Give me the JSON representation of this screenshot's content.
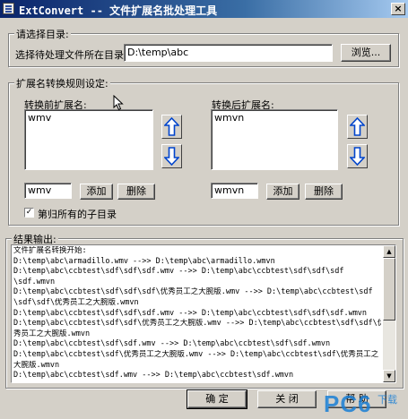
{
  "window": {
    "title": "ExtConvert -- 文件扩展名批处理工具",
    "close_glyph": "×"
  },
  "directory_group": {
    "legend": "请选择目录:",
    "label": "选择待处理文件所在目录：",
    "path_value": "D:\\temp\\abc",
    "browse_label": "浏览..."
  },
  "rules_group": {
    "legend": "扩展名转换规则设定:",
    "before": {
      "label": "转换前扩展名:",
      "items": [
        "wmv"
      ],
      "input_value": "wmv",
      "add_label": "添加",
      "delete_label": "删除"
    },
    "after": {
      "label": "转换后扩展名:",
      "items": [
        "wmvn"
      ],
      "input_value": "wmvn",
      "add_label": "添加",
      "delete_label": "删除"
    },
    "recursive_label": "第归所有的子目录",
    "recursive_checked": true,
    "check_glyph": "✓"
  },
  "output_group": {
    "legend": "结果输出:",
    "lines": [
      "文件扩展名转换开始:",
      "D:\\temp\\abc\\armadillo.wmv  -->>  D:\\temp\\abc\\armadillo.wmvn",
      "D:\\temp\\abc\\ccbtest\\sdf\\sdf\\sdf.wmv  -->>  D:\\temp\\abc\\ccbtest\\sdf\\sdf\\sdf",
      "\\sdf.wmvn",
      "D:\\temp\\abc\\ccbtest\\sdf\\sdf\\sdf\\优秀员工之大腕版.wmv  -->>  D:\\temp\\abc\\ccbtest\\sdf",
      "\\sdf\\sdf\\优秀员工之大腕版.wmvn",
      "D:\\temp\\abc\\ccbtest\\sdf\\sdf\\sdf.wmv  -->>  D:\\temp\\abc\\ccbtest\\sdf\\sdf\\sdf.wmvn",
      "D:\\temp\\abc\\ccbtest\\sdf\\sdf\\优秀员工之大腕版.wmv  -->>  D:\\temp\\abc\\ccbtest\\sdf\\sdf\\优",
      "秀员工之大腕版.wmvn",
      "D:\\temp\\abc\\ccbtest\\sdf\\sdf.wmv  -->>  D:\\temp\\abc\\ccbtest\\sdf\\sdf.wmvn",
      "D:\\temp\\abc\\ccbtest\\sdf\\优秀员工之大腕版.wmv  -->>  D:\\temp\\abc\\ccbtest\\sdf\\优秀员工之",
      "大腕版.wmvn",
      "D:\\temp\\abc\\ccbtest\\sdf.wmv  -->>  D:\\temp\\abc\\ccbtest\\sdf.wmvn"
    ]
  },
  "footer": {
    "ok_label": "确 定",
    "close_label": "关 闭",
    "help_label": "帮 助"
  },
  "watermark": {
    "brand": "PC6",
    "suffix": "下载"
  },
  "colors": {
    "titlebar_start": "#0a246a",
    "arrow_fill": "#0044cc",
    "watermark": "#1a7fd6"
  }
}
